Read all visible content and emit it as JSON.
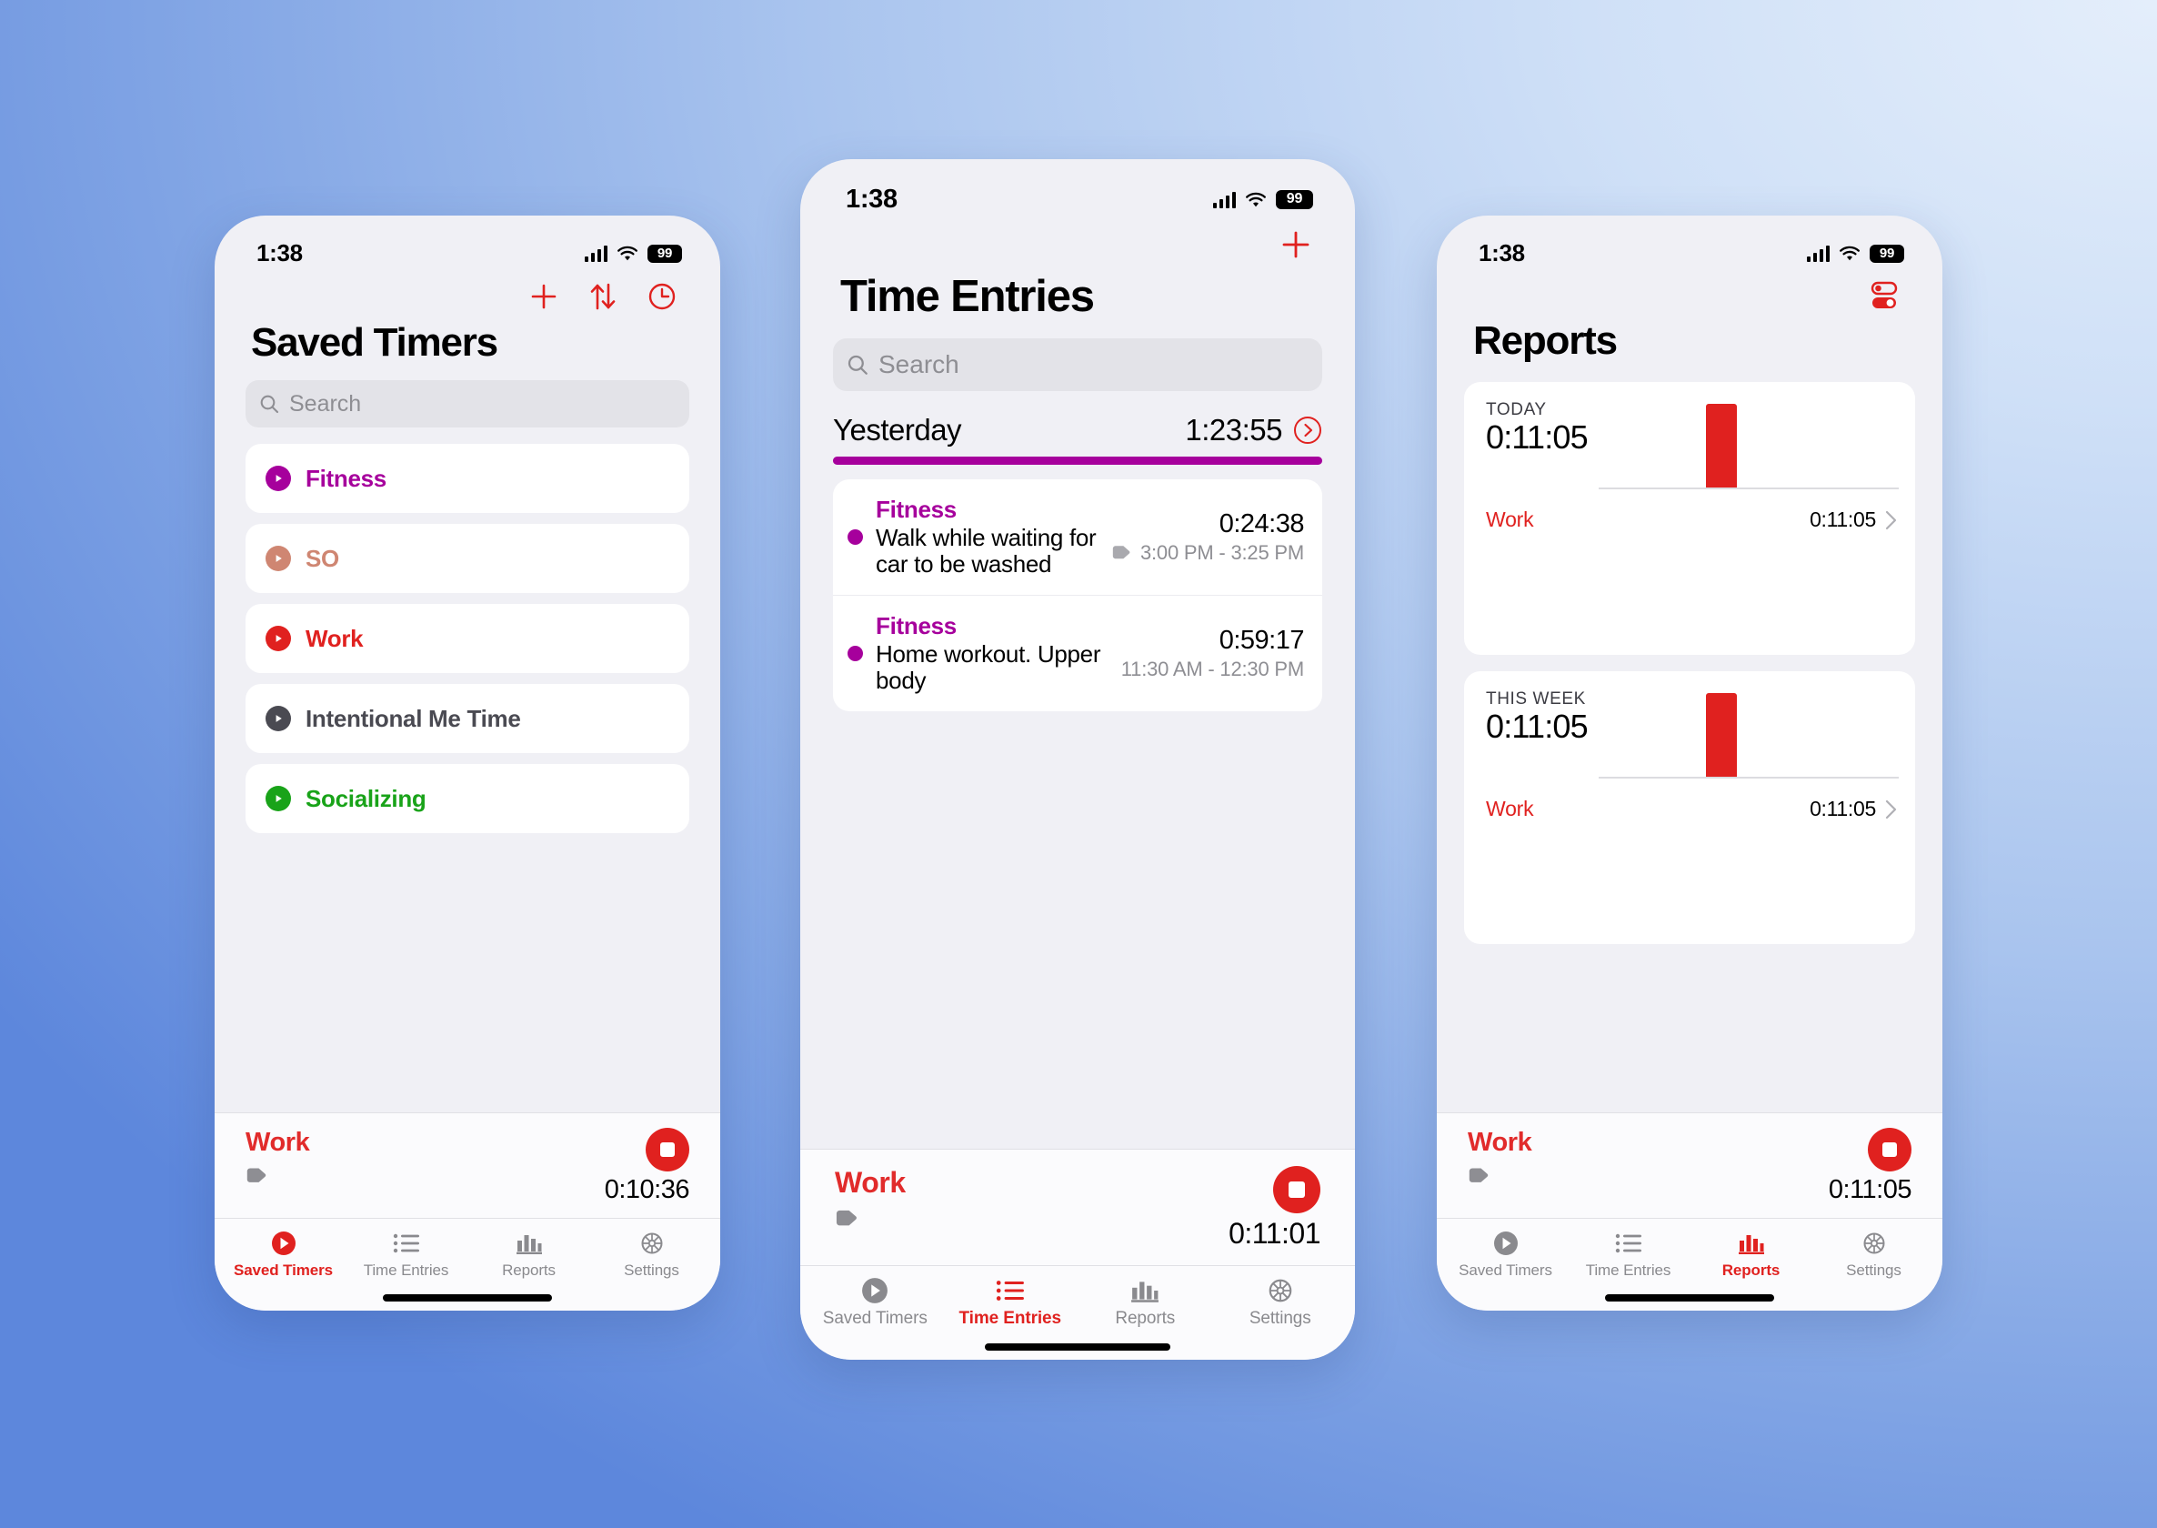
{
  "colors": {
    "red": "#e0211f",
    "purple": "#a6009c",
    "salmon": "#cf8672",
    "dark_gray": "#4a4a52",
    "green": "#19a319",
    "inactive_gray": "#8a8a8e"
  },
  "status_bar": {
    "time": "1:38",
    "battery": "99",
    "signal_icon": "cellular-signal-icon",
    "wifi_icon": "wifi-icon",
    "battery_icon": "battery-badge"
  },
  "tabs": [
    {
      "label": "Saved Timers",
      "icon": "play-circle-icon"
    },
    {
      "label": "Time Entries",
      "icon": "list-bullet-icon"
    },
    {
      "label": "Reports",
      "icon": "bar-chart-icon"
    },
    {
      "label": "Settings",
      "icon": "gear-icon"
    }
  ],
  "phone1": {
    "nav_icons": [
      {
        "name": "add-timer-icon",
        "glyph": "plus"
      },
      {
        "name": "sort-icon",
        "glyph": "arrows-up-down"
      },
      {
        "name": "history-clock-icon",
        "glyph": "clock"
      }
    ],
    "title": "Saved Timers",
    "search": {
      "placeholder": "Search",
      "value": "",
      "icon": "search-icon"
    },
    "timers": [
      {
        "name": "Fitness",
        "color": "#a6009c"
      },
      {
        "name": "SO",
        "color": "#cf8672"
      },
      {
        "name": "Work",
        "color": "#e0211f"
      },
      {
        "name": "Intentional Me Time",
        "color": "#4a4a52"
      },
      {
        "name": "Socializing",
        "color": "#19a319"
      }
    ],
    "running": {
      "name": "Work",
      "duration": "0:10:36",
      "tag_icon": "tag-icon",
      "stop_icon": "stop-button"
    },
    "active_tab": "Saved Timers"
  },
  "phone2": {
    "nav_icons": [
      {
        "name": "add-entry-icon",
        "glyph": "plus"
      }
    ],
    "title": "Time Entries",
    "search": {
      "placeholder": "Search",
      "value": "",
      "icon": "search-icon"
    },
    "group": {
      "day": "Yesterday",
      "total": "1:23:55",
      "chevron_icon": "chevron-right-circle-icon",
      "bar_color": "#a6009c"
    },
    "entries": [
      {
        "category": "Fitness",
        "color": "#a6009c",
        "note": "Walk while waiting for car to be washed",
        "duration": "0:24:38",
        "time_range": "3:00 PM - 3:25 PM",
        "has_tag": true,
        "tag_icon": "tag-icon"
      },
      {
        "category": "Fitness",
        "color": "#a6009c",
        "note": "Home workout. Upper body",
        "duration": "0:59:17",
        "time_range": "11:30 AM - 12:30 PM",
        "has_tag": false,
        "tag_icon": "tag-icon"
      }
    ],
    "running": {
      "name": "Work",
      "duration": "0:11:01",
      "tag_icon": "tag-icon",
      "stop_icon": "stop-button"
    },
    "active_tab": "Time Entries"
  },
  "phone3": {
    "nav_icons": [
      {
        "name": "report-filter-toggles-icon",
        "glyph": "toggles"
      }
    ],
    "title": "Reports",
    "cards": [
      {
        "label": "TODAY",
        "total": "0:11:05",
        "entry_name": "Work",
        "entry_value": "0:11:05",
        "entry_color": "#e0211f",
        "chevron_icon": "chevron-right-icon"
      },
      {
        "label": "THIS WEEK",
        "total": "0:11:05",
        "entry_name": "Work",
        "entry_value": "0:11:05",
        "entry_color": "#e0211f",
        "chevron_icon": "chevron-right-icon"
      }
    ],
    "running": {
      "name": "Work",
      "duration": "0:11:05",
      "tag_icon": "tag-icon",
      "stop_icon": "stop-button"
    },
    "active_tab": "Reports"
  },
  "chart_data": [
    {
      "type": "bar",
      "title": "TODAY",
      "categories": [
        "Work"
      ],
      "values": [
        665
      ],
      "value_labels": [
        "0:11:05"
      ],
      "ylabel": "seconds",
      "xlabel": "",
      "grid": false,
      "legend": "none",
      "bar_color": "#e0211f",
      "total": "0:11:05"
    },
    {
      "type": "bar",
      "title": "THIS WEEK",
      "categories": [
        "Work"
      ],
      "values": [
        665
      ],
      "value_labels": [
        "0:11:05"
      ],
      "ylabel": "seconds",
      "xlabel": "",
      "grid": false,
      "legend": "none",
      "bar_color": "#e0211f",
      "total": "0:11:05"
    }
  ]
}
